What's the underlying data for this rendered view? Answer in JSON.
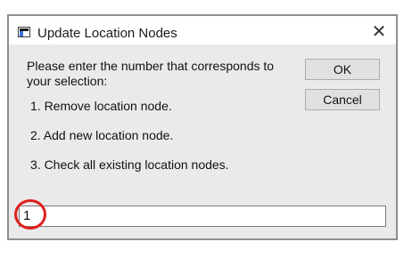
{
  "window": {
    "title": "Update Location Nodes",
    "close_glyph": "✕"
  },
  "prompt": "Please enter the number that corresponds to your selection:",
  "options": [
    "1. Remove location node.",
    "2. Add new location node.",
    "3. Check all existing location nodes."
  ],
  "buttons": {
    "ok": "OK",
    "cancel": "Cancel"
  },
  "input": {
    "value": "1"
  },
  "icons": {
    "app": "window-icon",
    "close": "close-icon"
  },
  "colors": {
    "annotation": "#e0201e"
  }
}
